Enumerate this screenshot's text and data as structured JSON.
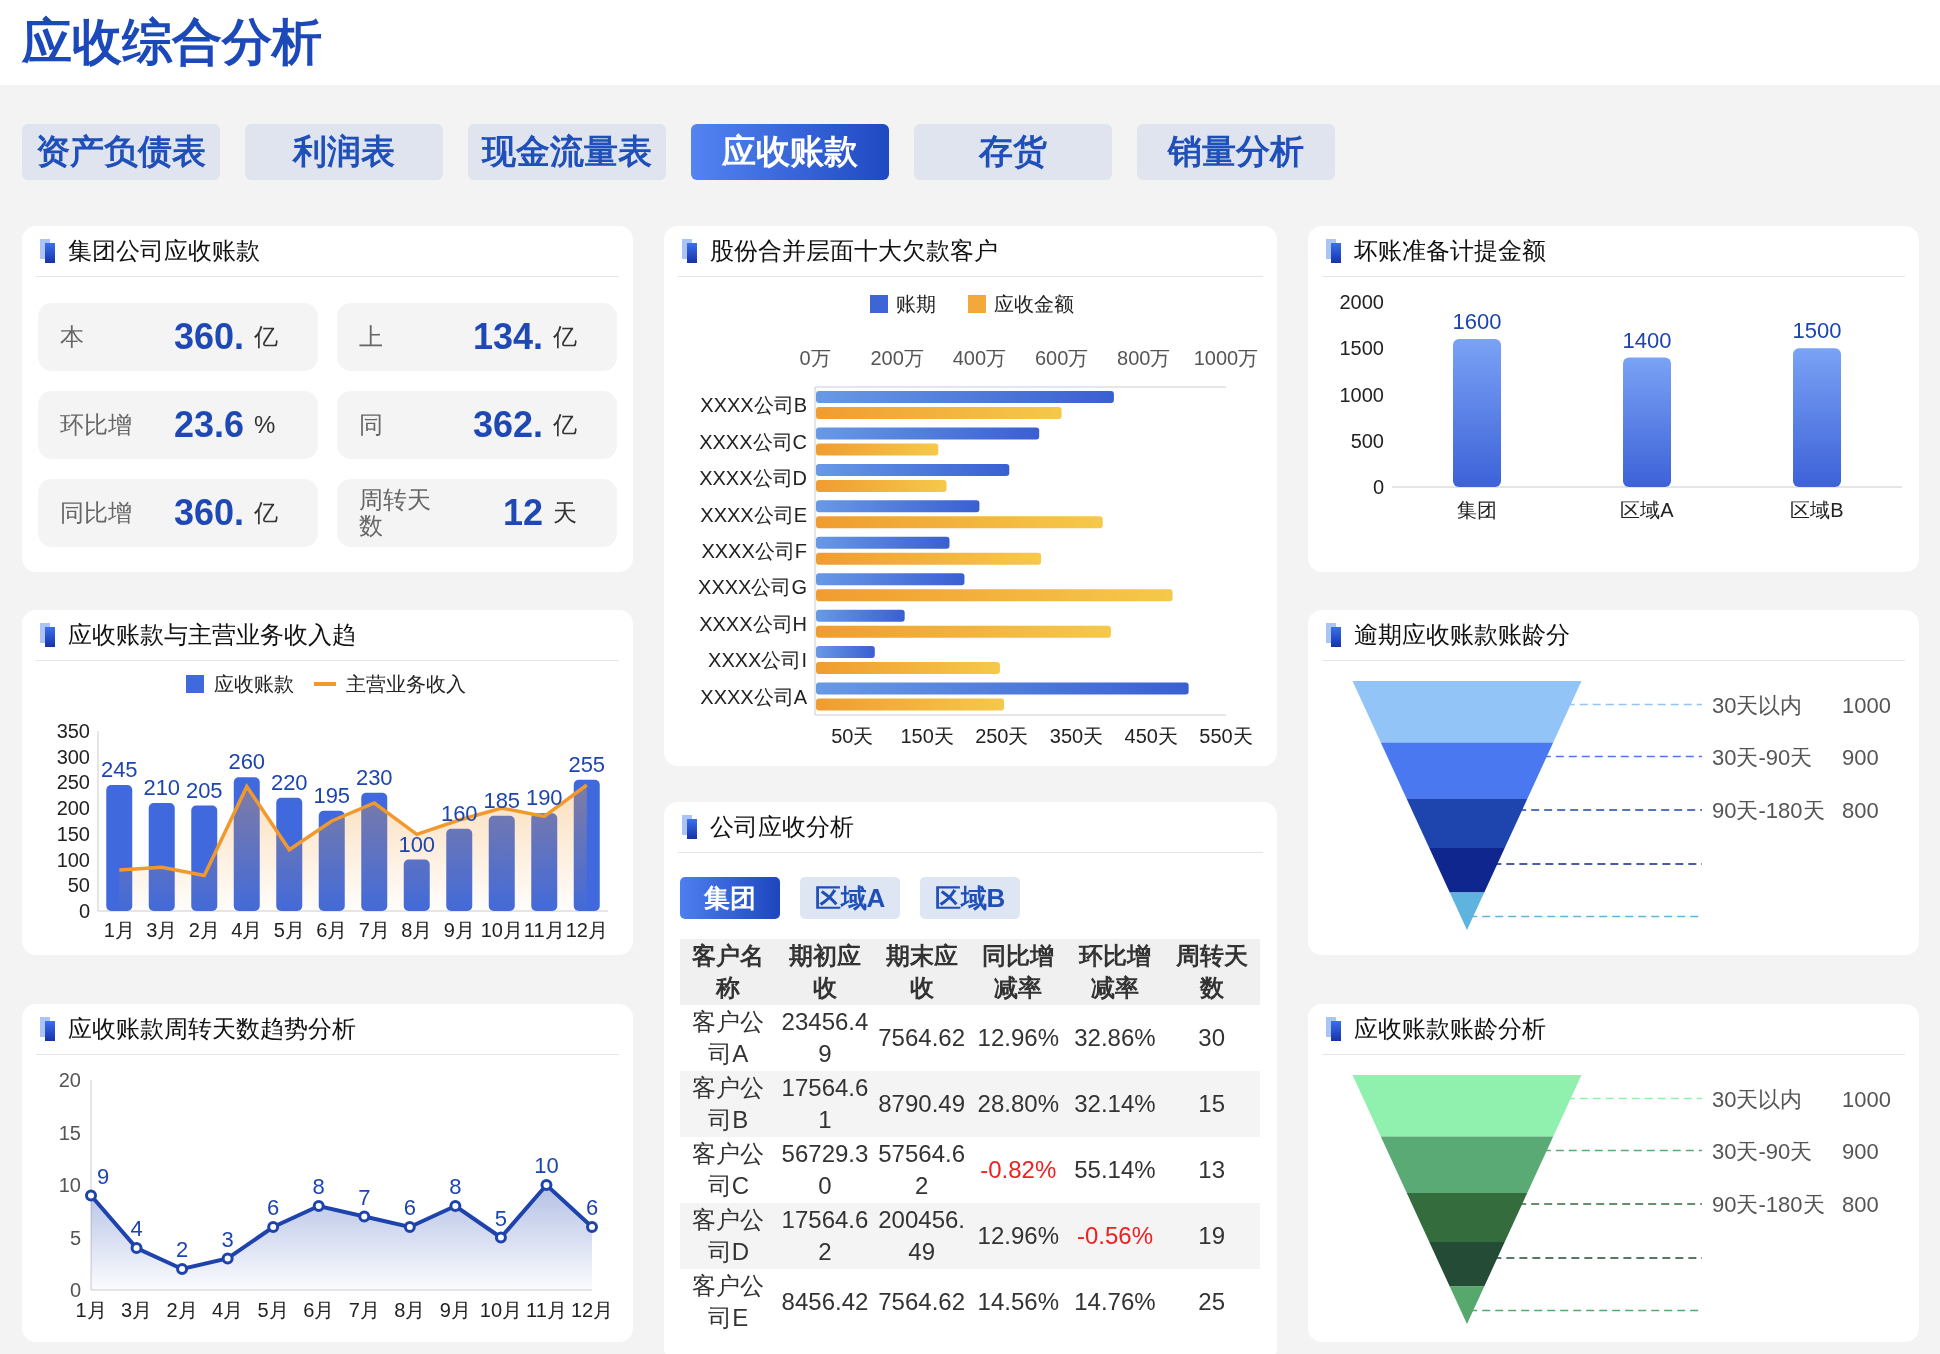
{
  "title": "应收综合分析",
  "tabs": [
    {
      "label": "资产负债表",
      "selected": false
    },
    {
      "label": "利润表",
      "selected": false
    },
    {
      "label": "现金流量表",
      "selected": false
    },
    {
      "label": "应收账款",
      "selected": true
    },
    {
      "label": "存货",
      "selected": false
    },
    {
      "label": "销量分析",
      "selected": false
    }
  ],
  "kpi_card": {
    "title": "集团公司应收账款",
    "tiles": [
      {
        "label": "本",
        "value": "360.",
        "unit": "亿"
      },
      {
        "label": "上",
        "value": "134.",
        "unit": "亿"
      },
      {
        "label": "环比增",
        "value": "23.6",
        "unit": "%"
      },
      {
        "label": "同",
        "value": "362.",
        "unit": "亿"
      },
      {
        "label": "同比增",
        "value": "360.",
        "unit": "亿"
      },
      {
        "label": "周转天数",
        "value": "12",
        "unit": "天"
      }
    ]
  },
  "trend_card": {
    "title": "应收账款与主营业务收入趋",
    "chart_data": {
      "type": "bar",
      "categories": [
        "1月",
        "3月",
        "2月",
        "4月",
        "5月",
        "6月",
        "7月",
        "8月",
        "9月",
        "10月",
        "11月",
        "12月"
      ],
      "ylim": [
        0,
        350
      ],
      "yticks": [
        0,
        50,
        100,
        150,
        200,
        250,
        300,
        350
      ],
      "legend": "top",
      "series": [
        {
          "name": "应收账款",
          "type": "bar",
          "data_labels": true,
          "color": "#3f69dc",
          "values": [
            245,
            210,
            205,
            260,
            220,
            195,
            230,
            100,
            160,
            185,
            190,
            255
          ]
        },
        {
          "name": "主营业务收入",
          "type": "line",
          "color": "#f0992f",
          "values": [
            80,
            85,
            69,
            242,
            119,
            175,
            210,
            149,
            177,
            200,
            184,
            245
          ]
        }
      ]
    }
  },
  "turnover_card": {
    "title": "应收账款周转天数趋势分析",
    "chart_data": {
      "type": "area",
      "categories": [
        "1月",
        "3月",
        "2月",
        "4月",
        "5月",
        "6月",
        "7月",
        "8月",
        "9月",
        "10月",
        "11月",
        "12月"
      ],
      "ylim": [
        0,
        20
      ],
      "yticks": [
        0,
        5,
        10,
        15,
        20
      ],
      "data_labels": true,
      "series": [
        {
          "color": "#1f43ad",
          "values": [
            9,
            4,
            2,
            3,
            6,
            8,
            7,
            6,
            8,
            5,
            10,
            6
          ]
        }
      ]
    }
  },
  "top_customers_card": {
    "title": "股份合并层面十大欠款客户",
    "chart_data": {
      "type": "bar",
      "orientation": "horizontal",
      "categories": [
        "XXXX公司B",
        "XXXX公司C",
        "XXXX公司D",
        "XXXX公司E",
        "XXXX公司F",
        "XXXX公司G",
        "XXXX公司H",
        "XXXX公司I",
        "XXXX公司A"
      ],
      "legend": "top",
      "xlim": [
        0,
        1000
      ],
      "x2lim": [
        0,
        550
      ],
      "xticks": [
        {
          "value": 0,
          "label": "0万"
        },
        {
          "value": 200,
          "label": "200万"
        },
        {
          "value": 400,
          "label": "400万"
        },
        {
          "value": 600,
          "label": "600万"
        },
        {
          "value": 800,
          "label": "800万"
        },
        {
          "value": 1000,
          "label": "1000万"
        }
      ],
      "x2ticks": [
        {
          "value": 50,
          "label": "50天"
        },
        {
          "value": 150,
          "label": "150天"
        },
        {
          "value": 250,
          "label": "250天"
        },
        {
          "value": 350,
          "label": "350天"
        },
        {
          "value": 450,
          "label": "450天"
        },
        {
          "value": 550,
          "label": "550天"
        }
      ],
      "series": [
        {
          "name": "账期",
          "axis": "x2",
          "color": "#3f64d6",
          "values": [
            400,
            300,
            260,
            220,
            180,
            200,
            120,
            80,
            500
          ]
        },
        {
          "name": "应收金额",
          "color": "#f2a93a",
          "values": [
            600,
            300,
            320,
            700,
            550,
            870,
            720,
            450,
            460
          ]
        }
      ]
    }
  },
  "company_card": {
    "title": "公司应收分析",
    "filters": [
      {
        "label": "集团",
        "selected": true
      },
      {
        "label": "区域A",
        "selected": false
      },
      {
        "label": "区域B",
        "selected": false
      }
    ],
    "table": {
      "columns": [
        "客户名称",
        "期初应收",
        "期末应收",
        "同比增减率",
        "环比增减率",
        "周转天数"
      ],
      "rows": [
        {
          "customer": "客户公司A",
          "opening": "23456.49",
          "closing": "7564.62",
          "yoy": {
            "text": "12.96%",
            "negative": false
          },
          "mom": {
            "text": "32.86%",
            "negative": false
          },
          "days": "30"
        },
        {
          "customer": "客户公司B",
          "opening": "17564.61",
          "closing": "8790.49",
          "yoy": {
            "text": "28.80%",
            "negative": false
          },
          "mom": {
            "text": "32.14%",
            "negative": false
          },
          "days": "15"
        },
        {
          "customer": "客户公司C",
          "opening": "56729.30",
          "closing": "57564.62",
          "yoy": {
            "text": "-0.82%",
            "negative": true
          },
          "mom": {
            "text": "55.14%",
            "negative": false
          },
          "days": "13"
        },
        {
          "customer": "客户公司D",
          "opening": "17564.62",
          "closing": "200456.49",
          "yoy": {
            "text": "12.96%",
            "negative": false
          },
          "mom": {
            "text": "-0.56%",
            "negative": true
          },
          "days": "19"
        },
        {
          "customer": "客户公司E",
          "opening": "8456.42",
          "closing": "7564.62",
          "yoy": {
            "text": "14.56%",
            "negative": false
          },
          "mom": {
            "text": "14.76%",
            "negative": false
          },
          "days": "25"
        }
      ]
    }
  },
  "bad_debt_card": {
    "title": "坏账准备计提金额",
    "chart_data": {
      "type": "bar",
      "categories": [
        "集团",
        "区域A",
        "区域B"
      ],
      "values": [
        1600,
        1400,
        1500
      ],
      "ylim": [
        0,
        2000
      ],
      "yticks": [
        0,
        500,
        1000,
        1500,
        2000
      ],
      "data_labels": true
    }
  },
  "funnels": [
    {
      "title": "逾期应收账款账龄分",
      "stages": [
        {
          "color": "#92c4f8"
        },
        {
          "color": "#4a78f0"
        },
        {
          "color": "#1e45ae"
        },
        {
          "color": "#0f268e"
        },
        {
          "color": "#5fb4df"
        }
      ],
      "labels": [
        {
          "text": "30天以内",
          "value": "1000"
        },
        {
          "text": "30天-90天",
          "value": "900"
        },
        {
          "text": "90天-180天",
          "value": "800"
        }
      ]
    },
    {
      "title": "应收账款账龄分析",
      "stages": [
        {
          "color": "#90f0ae"
        },
        {
          "color": "#5aaa76"
        },
        {
          "color": "#356c3d"
        },
        {
          "color": "#234b36"
        },
        {
          "color": "#56a86c"
        }
      ],
      "labels": [
        {
          "text": "30天以内",
          "value": "1000"
        },
        {
          "text": "30天-90天",
          "value": "900"
        },
        {
          "text": "90天-180天",
          "value": "800"
        }
      ]
    }
  ]
}
